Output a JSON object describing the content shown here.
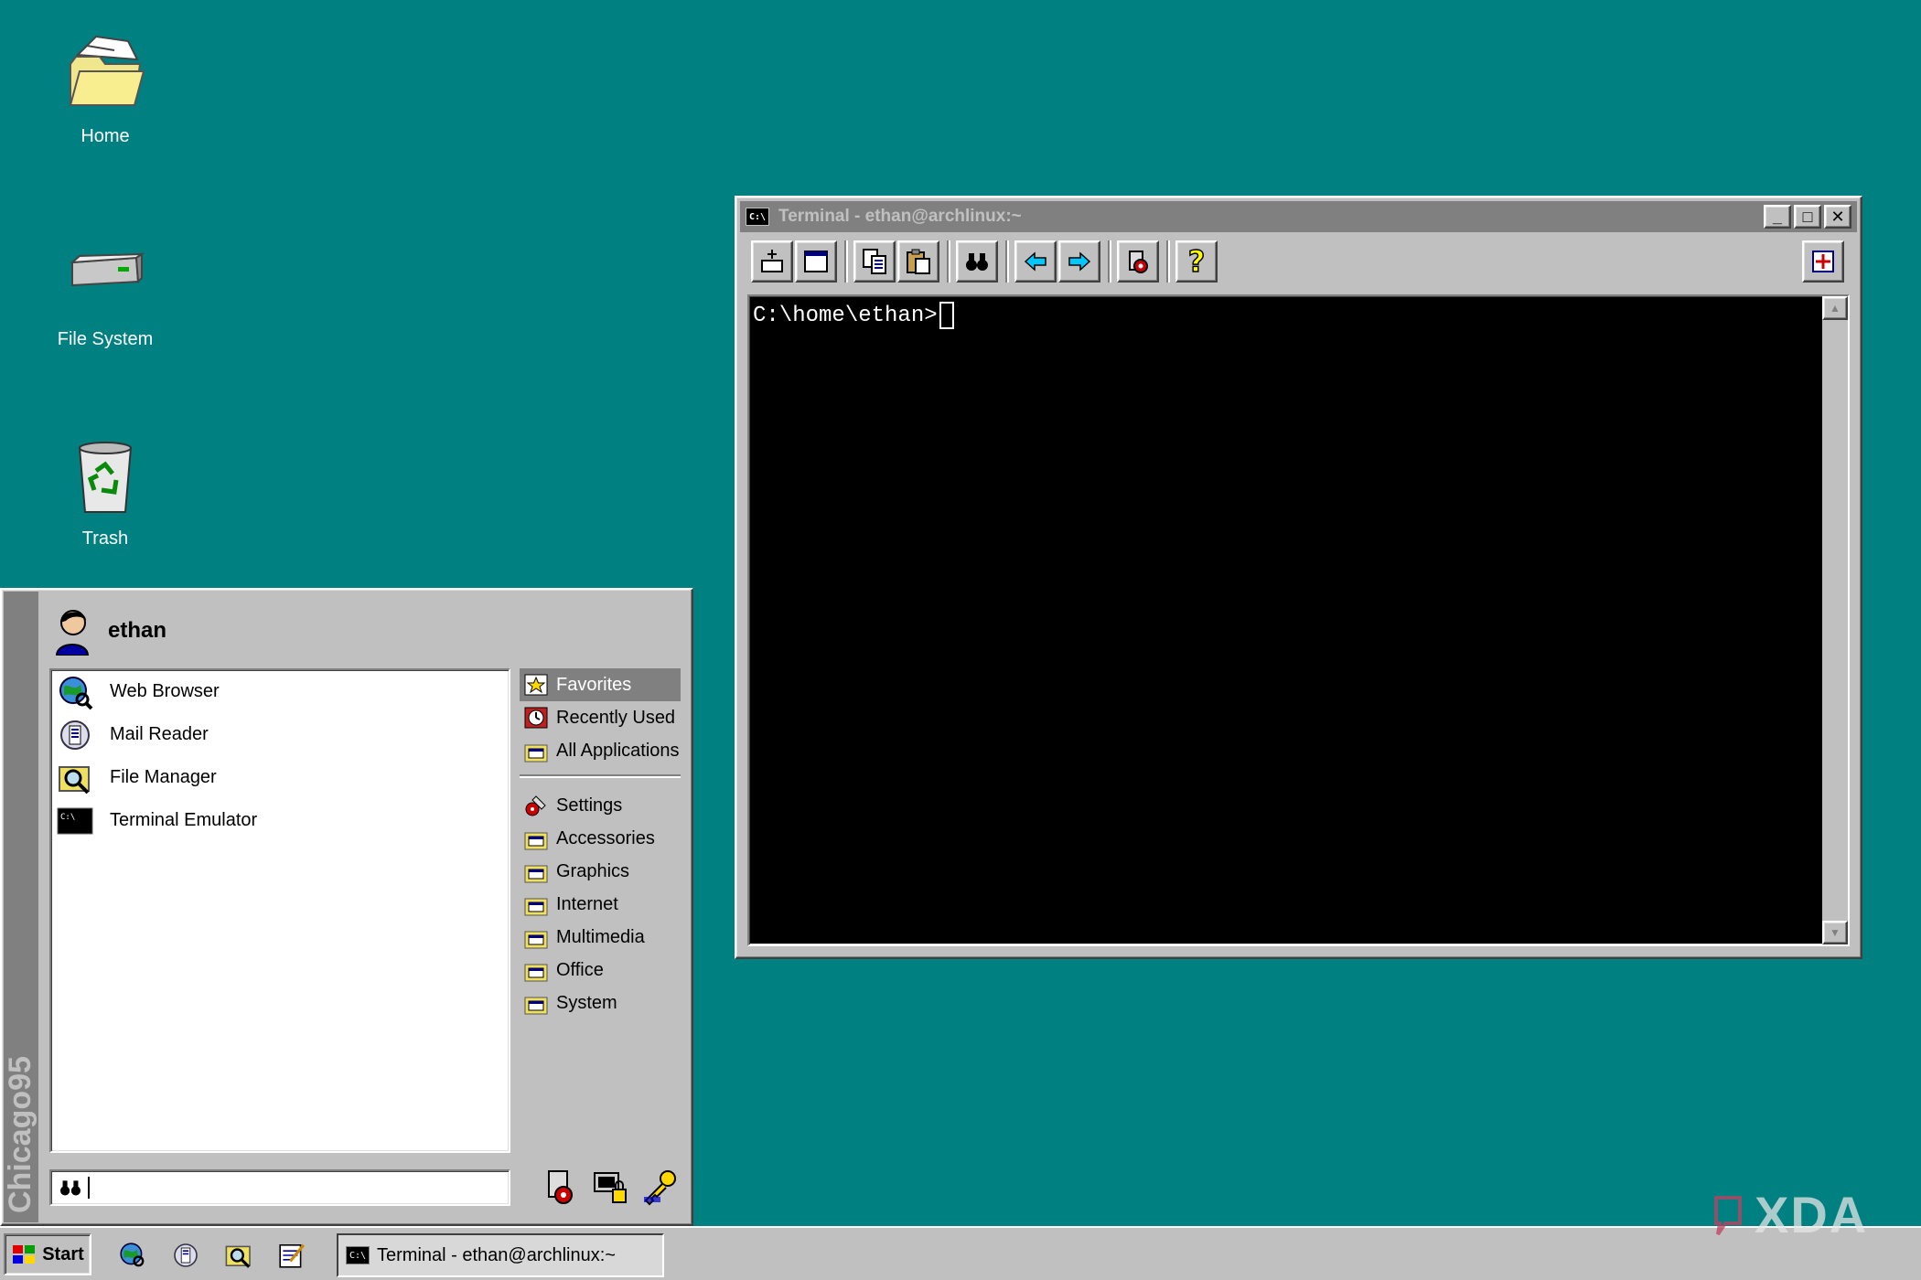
{
  "desktop": {
    "icons": [
      {
        "label": "Home",
        "icon": "folder-icon"
      },
      {
        "label": "File System",
        "icon": "drive-icon"
      },
      {
        "label": "Trash",
        "icon": "recycle-bin-icon"
      }
    ]
  },
  "terminal": {
    "title": "Terminal - ethan@archlinux:~",
    "prompt": "C:\\home\\ethan>",
    "toolbar_icons": [
      "new-tab-icon",
      "new-window-icon",
      "copy-icon",
      "paste-icon",
      "find-icon",
      "previous-tab-icon",
      "next-tab-icon",
      "preferences-icon",
      "help-icon",
      "fullscreen-icon"
    ]
  },
  "start_menu": {
    "banner": "Chicago95",
    "user": "ethan",
    "favorites": [
      {
        "label": "Web Browser",
        "icon": "globe-search-icon"
      },
      {
        "label": "Mail Reader",
        "icon": "mail-icon"
      },
      {
        "label": "File Manager",
        "icon": "file-manager-icon"
      },
      {
        "label": "Terminal Emulator",
        "icon": "terminal-icon"
      }
    ],
    "categories_top": [
      "Favorites",
      "Recently Used",
      "All Applications"
    ],
    "categories": [
      "Settings",
      "Accessories",
      "Graphics",
      "Internet",
      "Multimedia",
      "Office",
      "System"
    ],
    "selected_category": "Favorites",
    "search_value": ""
  },
  "taskbar": {
    "start_label": "Start",
    "quick_launch": [
      "browser-icon",
      "mail-icon",
      "file-manager-icon",
      "text-editor-icon"
    ],
    "tasks": [
      {
        "label": "Terminal - ethan@archlinux:~"
      }
    ]
  },
  "watermark": "XDA",
  "colors": {
    "desktop": "#008080",
    "chrome": "#c0c0c0",
    "inactive_title": "#808080"
  }
}
